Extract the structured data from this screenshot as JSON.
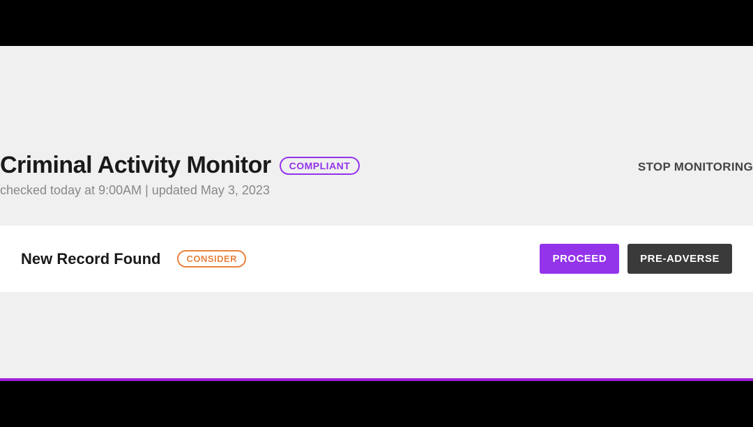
{
  "header": {
    "title": "Criminal Activity Monitor",
    "status_badge": "COMPLIANT",
    "subtitle": "checked today at 9:00AM | updated May 3, 2023",
    "stop_monitoring_label": "STOP MONITORING"
  },
  "record": {
    "title": "New Record Found",
    "status_badge": "CONSIDER",
    "proceed_label": "PROCEED",
    "pre_adverse_label": "PRE-ADVERSE"
  }
}
